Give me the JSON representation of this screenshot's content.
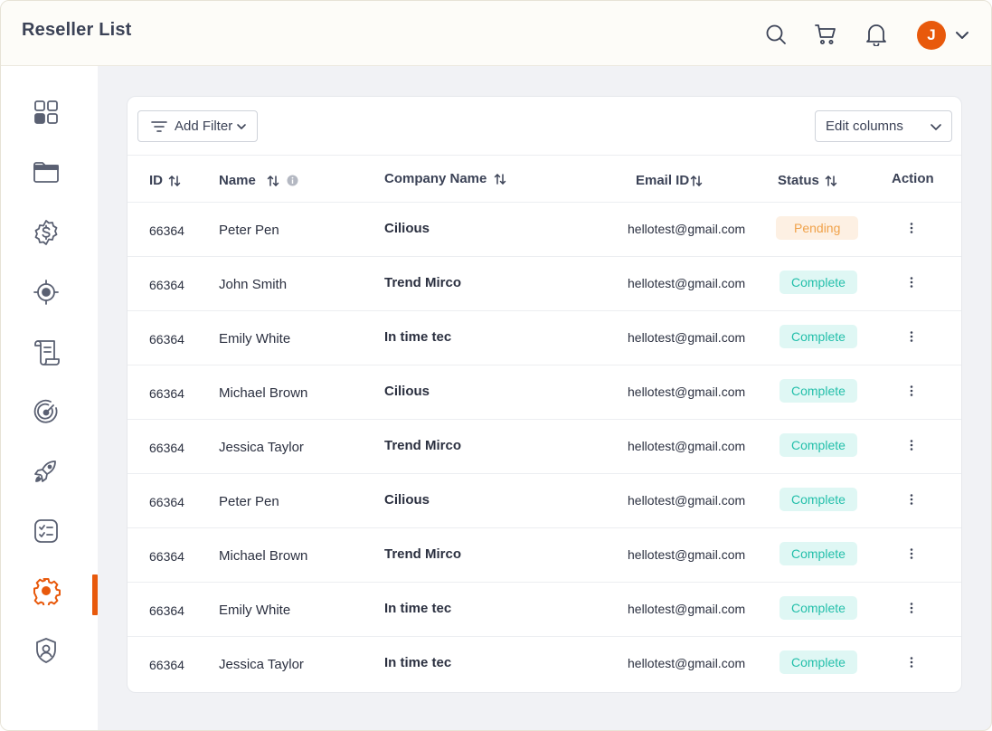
{
  "header": {
    "title": "Reseller List",
    "avatar_initial": "J",
    "icons": [
      "search-icon",
      "cart-icon",
      "bell-icon",
      "chevron-down-icon"
    ]
  },
  "sidebar": {
    "items": [
      {
        "icon": "dashboard-grid-icon",
        "active": false
      },
      {
        "icon": "folder-icon",
        "active": false
      },
      {
        "icon": "dollar-badge-icon",
        "active": false
      },
      {
        "icon": "target-icon",
        "active": false
      },
      {
        "icon": "scroll-icon",
        "active": false
      },
      {
        "icon": "gauge-icon",
        "active": false
      },
      {
        "icon": "rocket-icon",
        "active": false
      },
      {
        "icon": "checklist-icon",
        "active": false
      },
      {
        "icon": "gear-icon",
        "active": true
      },
      {
        "icon": "shield-user-icon",
        "active": false
      }
    ],
    "active_color": "#e8590c"
  },
  "toolbar": {
    "filter_label": "Add Filter",
    "columns_label": "Edit columns"
  },
  "table": {
    "headers": {
      "id": "ID",
      "name": "Name",
      "company": "Company Name",
      "email": "Email ID",
      "status": "Status",
      "action": "Action"
    },
    "rows": [
      {
        "id": "66364",
        "name": "Peter Pen",
        "company": "Cilious",
        "email": "hellotest@gmail.com",
        "status": "Pending"
      },
      {
        "id": "66364",
        "name": "John Smith",
        "company": "Trend Mirco",
        "email": "hellotest@gmail.com",
        "status": "Complete"
      },
      {
        "id": "66364",
        "name": "Emily White",
        "company": "In time tec",
        "email": "hellotest@gmail.com",
        "status": "Complete"
      },
      {
        "id": "66364",
        "name": "Michael Brown",
        "company": "Cilious",
        "email": "hellotest@gmail.com",
        "status": "Complete"
      },
      {
        "id": "66364",
        "name": "Jessica Taylor",
        "company": "Trend Mirco",
        "email": "hellotest@gmail.com",
        "status": "Complete"
      },
      {
        "id": "66364",
        "name": "Peter Pen",
        "company": "Cilious",
        "email": "hellotest@gmail.com",
        "status": "Complete"
      },
      {
        "id": "66364",
        "name": "Michael Brown",
        "company": "Trend Mirco",
        "email": "hellotest@gmail.com",
        "status": "Complete"
      },
      {
        "id": "66364",
        "name": "Emily White",
        "company": "In time tec",
        "email": "hellotest@gmail.com",
        "status": "Complete"
      },
      {
        "id": "66364",
        "name": "Jessica Taylor",
        "company": "In time tec",
        "email": "hellotest@gmail.com",
        "status": "Complete"
      }
    ]
  },
  "colors": {
    "brand": "#e8590c",
    "complete_bg": "#dff7f4",
    "complete_text": "#23bfaa",
    "pending_bg": "#fdf0e3",
    "pending_text": "#f0a24a"
  }
}
